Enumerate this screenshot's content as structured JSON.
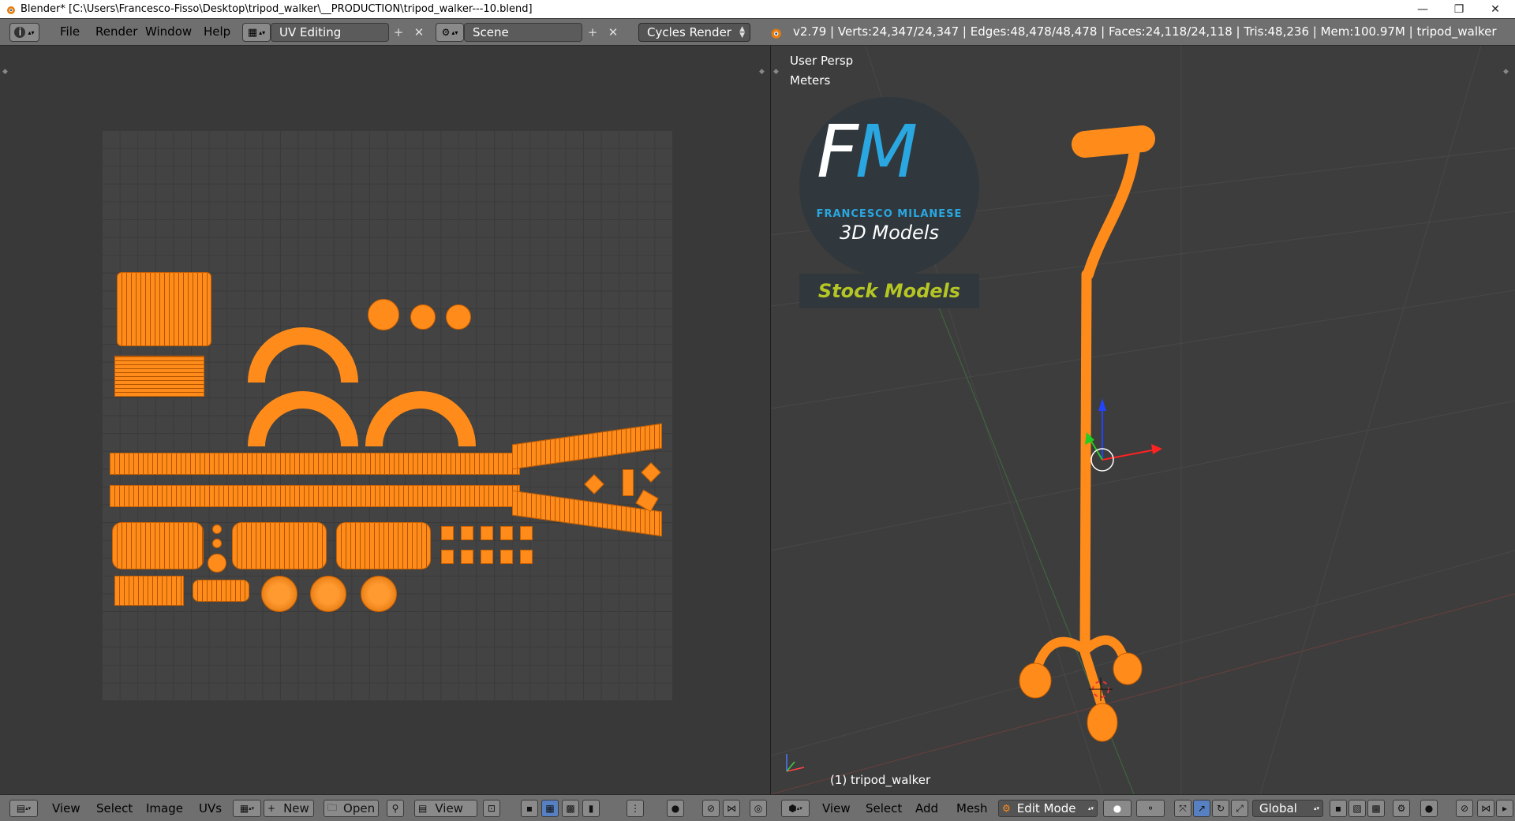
{
  "window": {
    "title": "Blender* [C:\\Users\\Francesco-Fisso\\Desktop\\tripod_walker\\__PRODUCTION\\tripod_walker---10.blend]",
    "minimize": "—",
    "restore": "❐",
    "close": "✕"
  },
  "header": {
    "menus": [
      "File",
      "Render",
      "Window",
      "Help"
    ],
    "layout": "UV Editing",
    "scene": "Scene",
    "engine": "Cycles Render",
    "stats": "v2.79 | Verts:24,347/24,347 | Edges:48,478/48,478 | Faces:24,118/24,118 | Tris:48,236 | Mem:100.97M | tripod_walker"
  },
  "viewport": {
    "view_name": "User Persp",
    "units": "Meters",
    "object_label": "(1) tripod_walker",
    "logo": {
      "letters": "FM",
      "name": "FRANCESCO MILANESE",
      "tagline": "3D Models",
      "banner": "Stock Models"
    }
  },
  "uv_footer": {
    "view": "View",
    "select": "Select",
    "image": "Image",
    "uvs": "UVs",
    "new": "New",
    "open": "Open",
    "view2": "View"
  },
  "view3d_footer": {
    "view": "View",
    "select": "Select",
    "add": "Add",
    "mesh": "Mesh",
    "mode": "Edit Mode",
    "orientation": "Global"
  },
  "colors": {
    "accent": "#ff8c1a",
    "header": "#6f6f6f",
    "logo_blue": "#2aa7e0",
    "banner_text": "#b5c624"
  }
}
